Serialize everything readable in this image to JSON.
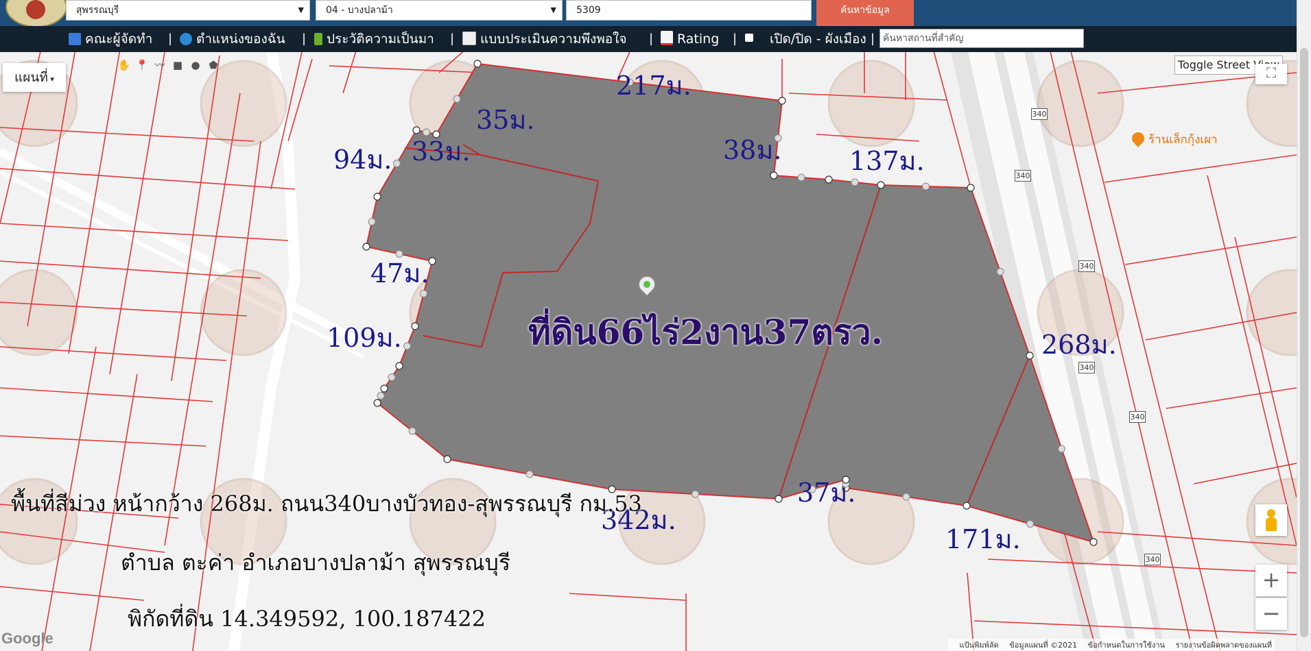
{
  "header": {
    "province": "สุพรรณบุรี",
    "district": "04 - บางปลาม้า",
    "parcel_number": "5309",
    "search_button": "ค้นหาข้อมูล"
  },
  "nav": {
    "items": [
      {
        "label": "คณะผู้จัดทำ",
        "icon": "team-icon"
      },
      {
        "label": "ตำแหน่งของฉัน",
        "icon": "globe-icon"
      },
      {
        "label": "ประวัติความเป็นมา",
        "icon": "sprout-icon"
      },
      {
        "label": "แบบประเมินความพึงพอใจ",
        "icon": "form-icon"
      },
      {
        "label": "Rating",
        "icon": "chart-icon"
      },
      {
        "label": "เปิด/ปิด - ผังเมือง",
        "icon": "checkbox-icon"
      }
    ],
    "search_placeholder": "ค้นหาสถานที่สำคัญ"
  },
  "map": {
    "map_type": "แผนที่",
    "toggle_street_view": "Toggle Street View",
    "zoom_in": "+",
    "zoom_out": "−",
    "google": "Google",
    "poi": "ร้านเล็กกุ้งเผา",
    "road_number": "340",
    "footer": [
      "แป้นพิมพ์ลัด",
      "ข้อมูลแผนที่ ©2021",
      "ข้อกำหนดในการใช้งาน",
      "รายงานข้อผิดพลาดของแผนที่"
    ],
    "drawing_tools": [
      "hand-icon",
      "marker-icon",
      "polyline-icon",
      "rectangle-icon",
      "circle-icon",
      "polygon-icon"
    ],
    "colors": {
      "parcel_fill": "#808080",
      "parcel_line": "#d23030",
      "boundary_line": "#e03a3a",
      "label": "#1a1a8c"
    }
  },
  "overlay": {
    "area": "ที่ดิน66ไร่2งาน37ตรว.",
    "dimensions": [
      "217ม.",
      "35ม.",
      "33ม.",
      "94ม.",
      "38ม.",
      "137ม.",
      "47ม.",
      "109ม.",
      "268ม.",
      "37ม.",
      "342ม.",
      "171ม."
    ],
    "info_lines": [
      "พื้นที่สีม่วง หน้ากว้าง 268ม. ถนน340บางบัวทอง-สุพรรณบุรี กม.53",
      "ตำบล ตะค่า อำเภอบางปลาม้า สุพรรณบุรี",
      "พิกัดที่ดิน 14.349592, 100.187422"
    ]
  }
}
